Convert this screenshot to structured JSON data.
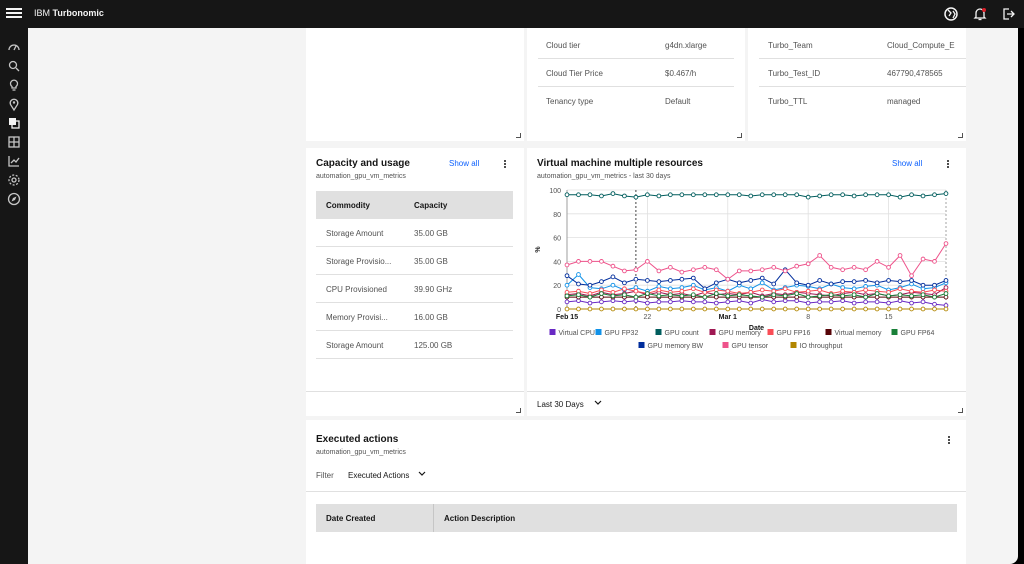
{
  "header": {
    "brand_prefix": "IBM",
    "brand_name": "Turbonomic"
  },
  "properties_left": [
    {
      "label": "Cloud tier",
      "value": "g4dn.xlarge"
    },
    {
      "label": "Cloud Tier Price",
      "value": "$0.467/h"
    },
    {
      "label": "Tenancy type",
      "value": "Default"
    }
  ],
  "properties_right": [
    {
      "label": "Turbo_Team",
      "value": "Cloud_Compute_E"
    },
    {
      "label": "Turbo_Test_ID",
      "value": "467790,478565"
    },
    {
      "label": "Turbo_TTL",
      "value": "managed"
    }
  ],
  "capacity": {
    "title": "Capacity and usage",
    "subtitle": "automation_gpu_vm_metrics",
    "show_all": "Show all",
    "columns": [
      "Commodity",
      "Capacity"
    ],
    "rows": [
      [
        "Storage Amount",
        "35.00 GB"
      ],
      [
        "Storage Provisio...",
        "35.00 GB"
      ],
      [
        "CPU Provisioned",
        "39.90 GHz"
      ],
      [
        "Memory Provisi...",
        "16.00 GB"
      ],
      [
        "Storage Amount",
        "125.00 GB"
      ]
    ]
  },
  "vmchart": {
    "title": "Virtual machine multiple resources",
    "subtitle": "automation_gpu_vm_metrics - last 30 days",
    "show_all": "Show all",
    "range_label": "Last 30 Days"
  },
  "chart_data": {
    "type": "line",
    "xlabel": "Date",
    "ylabel": "%",
    "ylim": [
      0,
      100
    ],
    "yticks": [
      0,
      20,
      40,
      60,
      80,
      100
    ],
    "xticks": [
      {
        "i": 0,
        "label": "Feb 15"
      },
      {
        "i": 7,
        "label": "22"
      },
      {
        "i": 14,
        "label": "Mar 1"
      },
      {
        "i": 21,
        "label": "8"
      },
      {
        "i": 28,
        "label": "15"
      }
    ],
    "grid": true,
    "legend_position": "bottom",
    "series": [
      {
        "name": "Virtual CPU",
        "color": "#6929c4",
        "values": [
          6,
          7,
          5,
          6,
          7,
          6,
          7,
          5,
          6,
          6,
          7,
          6,
          6,
          5,
          6,
          7,
          5,
          8,
          6,
          7,
          7,
          5,
          6,
          6,
          7,
          5,
          6,
          6,
          5,
          7,
          5,
          6,
          4,
          3
        ]
      },
      {
        "name": "GPU FP32",
        "color": "#1192e8",
        "values": [
          20,
          29,
          18,
          17,
          20,
          16,
          18,
          15,
          19,
          17,
          18,
          20,
          16,
          18,
          15,
          20,
          17,
          22,
          16,
          18,
          20,
          19,
          17,
          21,
          18,
          17,
          19,
          20,
          16,
          18,
          21,
          17,
          18,
          22
        ]
      },
      {
        "name": "GPU count",
        "color": "#005d5d",
        "values": [
          96,
          96,
          96,
          95,
          97,
          95,
          94,
          96,
          95,
          96,
          96,
          96,
          96,
          96,
          96,
          96,
          95,
          96,
          96,
          96,
          96,
          94,
          95,
          96,
          96,
          95,
          96,
          96,
          96,
          94,
          96,
          95,
          96,
          97
        ]
      },
      {
        "name": "GPU memory",
        "color": "#9f1853",
        "values": [
          12,
          13,
          11,
          14,
          12,
          13,
          15,
          12,
          14,
          12,
          13,
          11,
          14,
          12,
          13,
          12,
          14,
          11,
          13,
          12,
          14,
          13,
          12,
          11,
          13,
          14,
          12,
          13,
          11,
          12,
          14,
          13,
          12,
          18
        ]
      },
      {
        "name": "GPU FP16",
        "color": "#fa4d56",
        "values": [
          14,
          15,
          13,
          16,
          14,
          17,
          15,
          13,
          16,
          14,
          15,
          17,
          14,
          16,
          15,
          13,
          14,
          16,
          15,
          17,
          14,
          15,
          16,
          13,
          15,
          14,
          16,
          15,
          14,
          17,
          15,
          14,
          16,
          15
        ]
      },
      {
        "name": "Virtual memory",
        "color": "#570408",
        "values": [
          10,
          10,
          10,
          10,
          10,
          10,
          10,
          10,
          10,
          10,
          10,
          10,
          10,
          10,
          10,
          10,
          10,
          10,
          10,
          10,
          10,
          10,
          10,
          10,
          10,
          10,
          10,
          10,
          10,
          10,
          10,
          10,
          10,
          10
        ]
      },
      {
        "name": "GPU FP64",
        "color": "#198038",
        "values": [
          11,
          12,
          10,
          13,
          11,
          12,
          10,
          13,
          11,
          12,
          11,
          12,
          10,
          13,
          11,
          12,
          11,
          10,
          12,
          11,
          13,
          10,
          11,
          12,
          11,
          12,
          10,
          13,
          11,
          12,
          11,
          12,
          10,
          13
        ]
      },
      {
        "name": "GPU memory BW",
        "color": "#002d9c",
        "values": [
          28,
          21,
          20,
          23,
          27,
          22,
          25,
          24,
          23,
          24,
          25,
          26,
          17,
          22,
          25,
          22,
          24,
          26,
          21,
          33,
          22,
          20,
          24,
          21,
          23,
          23,
          24,
          22,
          24,
          23,
          24,
          20,
          20,
          24
        ]
      },
      {
        "name": "GPU tensor",
        "color": "#ee538b",
        "values": [
          37,
          40,
          40,
          40,
          36,
          32,
          33,
          40,
          32,
          35,
          31,
          33,
          35,
          33,
          25,
          32,
          32,
          33,
          35,
          32,
          36,
          38,
          45,
          35,
          33,
          35,
          33,
          40,
          35,
          45,
          28,
          42,
          40,
          55
        ]
      },
      {
        "name": "IO throughput",
        "color": "#b28600",
        "values": [
          0,
          0,
          0,
          0,
          0,
          0,
          0,
          0,
          0,
          0,
          0,
          0,
          0,
          0,
          0,
          0,
          0,
          0,
          0,
          0,
          0,
          0,
          0,
          0,
          0,
          0,
          0,
          0,
          0,
          0,
          0,
          0,
          0,
          0
        ]
      }
    ]
  },
  "executed": {
    "title": "Executed actions",
    "subtitle": "automation_gpu_vm_metrics",
    "filter_label": "Filter",
    "filter_value": "Executed Actions",
    "columns": [
      "Date Created",
      "Action Description"
    ]
  }
}
